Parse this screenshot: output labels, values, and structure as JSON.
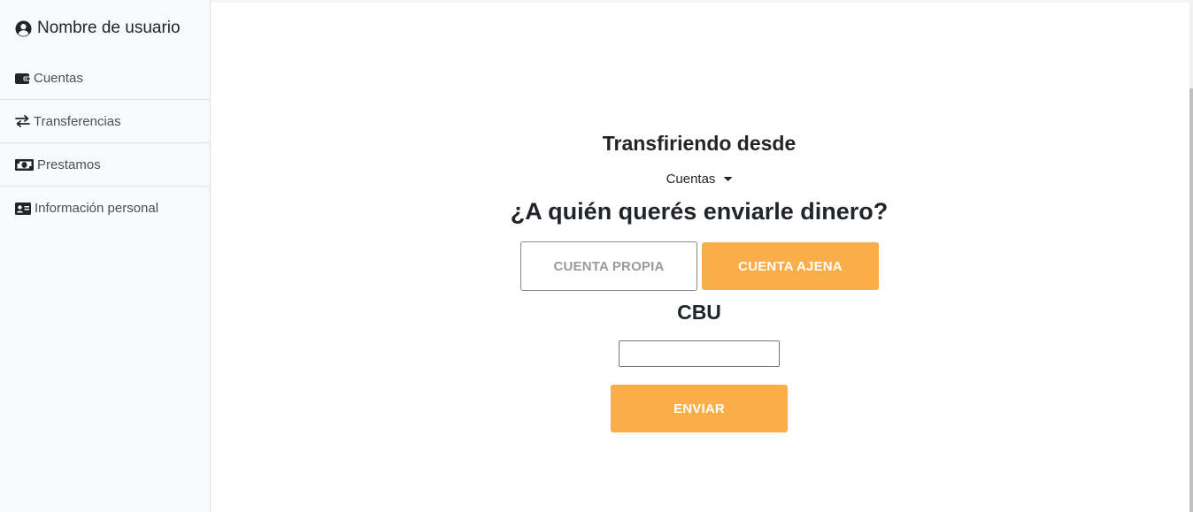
{
  "sidebar": {
    "user_name": "Nombre de usuario",
    "user_icon": "user-circle-icon",
    "items": [
      {
        "label": "Cuentas",
        "icon": "wallet-icon"
      },
      {
        "label": "Transferencias",
        "icon": "exchange-arrows-icon"
      },
      {
        "label": "Prestamos",
        "icon": "money-bill-icon"
      },
      {
        "label": "Información personal",
        "icon": "id-card-icon"
      }
    ]
  },
  "main": {
    "title": "Transfiriendo desde",
    "account_selector": "Cuentas",
    "question": "¿A quién querés enviarle dinero?",
    "own_account_button": "CUENTA PROPIA",
    "other_account_button": "CUENTA AJENA",
    "cbu_label": "CBU",
    "cbu_value": "",
    "send_button": "ENVIAR"
  },
  "colors": {
    "accent": "#fbae48",
    "sidebar_bg": "#f8f9fa",
    "text": "#212529"
  }
}
